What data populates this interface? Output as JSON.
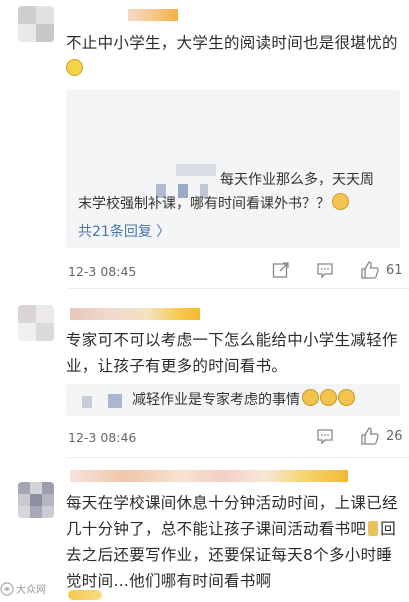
{
  "comments": [
    {
      "text": "不止中小学生，大学生的阅读时间也是很堪忧的",
      "reply": {
        "text_line1": "每天作业那么多，天天周",
        "text_line2": "末学校强制补课，哪有时间看课外书？？",
        "more": "共21条回复 〉"
      },
      "time": "12-3 08:45",
      "likes": "61"
    },
    {
      "text": "专家可不可以考虑一下怎么能给中小学生减轻作业，让孩子有更多的时间看书。",
      "reply": {
        "text": "减轻作业是专家考虑的事情"
      },
      "time": "12-3 08:46",
      "likes": "26"
    },
    {
      "text": "每天在学校课间休息十分钟活动时间，上课已经几十分钟了，总不能让孩子课间活动看书吧",
      "text2": "回去之后还要写作业，还要保证每天8个多小时睡觉时间…他们哪有时间看书啊"
    }
  ],
  "watermark": "大众网",
  "icons": {
    "share": "share-icon",
    "comment": "comment-icon",
    "like": "thumbs-up-icon"
  }
}
